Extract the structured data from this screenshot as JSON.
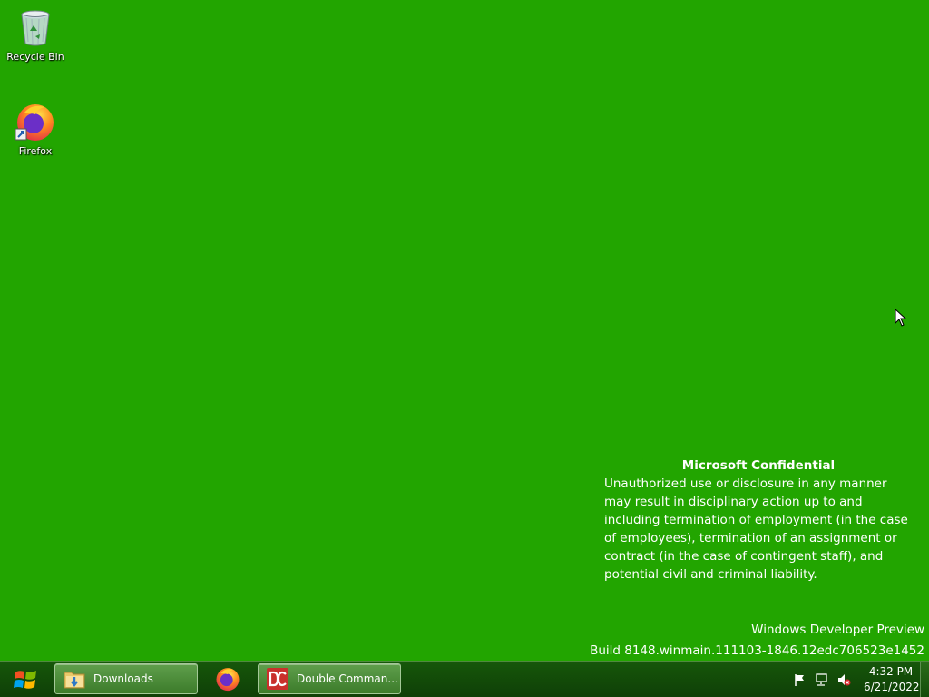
{
  "desktop": {
    "background_color": "#22a500",
    "icons": [
      {
        "label": "Recycle Bin",
        "icon": "recycle-bin-icon"
      },
      {
        "label": "Firefox",
        "icon": "firefox-icon"
      }
    ]
  },
  "watermark": {
    "title": "Microsoft Confidential",
    "body": "Unauthorized use or disclosure in any manner may result in disciplinary action up to and including termination of employment (in the case of employees), termination of an assignment or contract (in the case of contingent staff), and potential civil and criminal liability."
  },
  "build_info": {
    "line1": "Windows Developer Preview",
    "line2": "Build 8148.winmain.111103-1846.12edc706523e1452"
  },
  "taskbar": {
    "start_icon": "windows-logo-icon",
    "buttons": [
      {
        "label": "Downloads",
        "icon": "folder-downloads-icon"
      },
      {
        "label": "",
        "icon": "firefox-icon"
      },
      {
        "label": "Double Comman...",
        "icon": "double-commander-icon"
      }
    ],
    "tray": {
      "icons": [
        "flag-icon",
        "network-icon",
        "volume-muted-icon"
      ],
      "time": "4:32 PM",
      "date": "6/21/2022"
    }
  }
}
